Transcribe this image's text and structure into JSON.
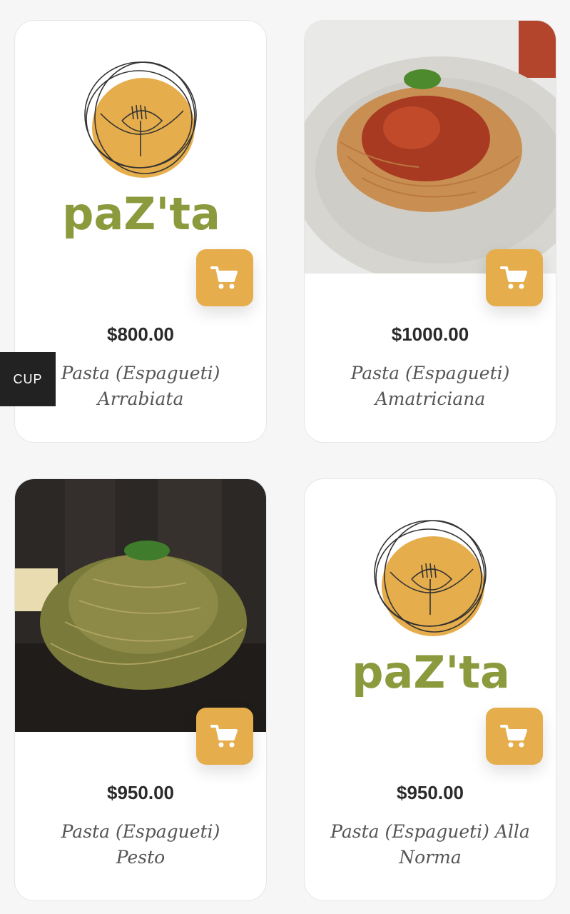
{
  "side_tab": {
    "label": "CUP"
  },
  "logo": {
    "text": "paZ'ta"
  },
  "colors": {
    "accent": "#e6ad4c",
    "logo_green": "#8a9a3c",
    "background": "#f6f6f6"
  },
  "products": [
    {
      "price": "$800.00",
      "name": "Pasta (Espagueti) Arrabiata",
      "image": "logo",
      "cart_icon": "cart-icon"
    },
    {
      "price": "$1000.00",
      "name": "Pasta (Espagueti) Amatriciana",
      "image": "spaghetti-tomato-photo",
      "cart_icon": "cart-icon"
    },
    {
      "price": "$950.00",
      "name": "Pasta (Espagueti) Pesto",
      "image": "spaghetti-pesto-photo",
      "cart_icon": "cart-icon"
    },
    {
      "price": "$950.00",
      "name": "Pasta (Espagueti) Alla Norma",
      "image": "logo",
      "cart_icon": "cart-icon"
    }
  ]
}
